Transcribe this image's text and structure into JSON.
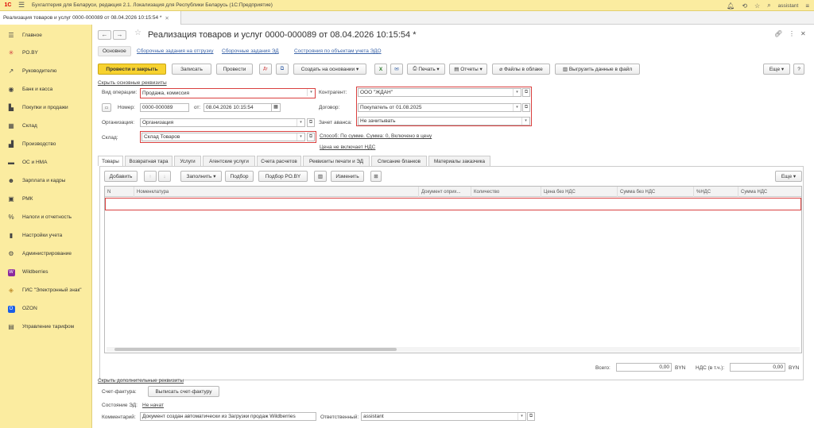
{
  "titlebar": {
    "logo": "1С",
    "app_title": "Бухгалтерия для Беларуси, редакция 2.1. Локализация для Республики Беларусь   (1С:Предприятие)",
    "user": "assistant"
  },
  "doc_tab": {
    "label": "Реализация товаров и услуг 0000-000089 от 08.04.2026 10:15:54 *",
    "close": "✕"
  },
  "sidebar": {
    "items": [
      {
        "label": "Главное",
        "icon": "menu-icon"
      },
      {
        "label": "PO.BY",
        "icon": "poby-icon"
      },
      {
        "label": "Руководителю",
        "icon": "chart-icon"
      },
      {
        "label": "Банк и касса",
        "icon": "bank-icon"
      },
      {
        "label": "Покупки и продажи",
        "icon": "cart-icon"
      },
      {
        "label": "Склад",
        "icon": "warehouse-icon"
      },
      {
        "label": "Производство",
        "icon": "factory-icon"
      },
      {
        "label": "ОС и НМА",
        "icon": "car-icon"
      },
      {
        "label": "Зарплата и кадры",
        "icon": "people-icon"
      },
      {
        "label": "РМК",
        "icon": "register-icon"
      },
      {
        "label": "Налоги и отчетность",
        "icon": "percent-icon"
      },
      {
        "label": "Настройки учета",
        "icon": "book-icon"
      },
      {
        "label": "Администрирование",
        "icon": "gear-icon"
      },
      {
        "label": "Wildberries",
        "icon": "wb-icon"
      },
      {
        "label": "ГИС \"Электронный знак\"",
        "icon": "diamond-icon"
      },
      {
        "label": "OZON",
        "icon": "ozon-icon"
      },
      {
        "label": "Управление тарифом",
        "icon": "tariff-icon"
      }
    ]
  },
  "header": {
    "title": "Реализация товаров и услуг 0000-000089 от 08.04.2026 10:15:54 *",
    "back": "←",
    "forward": "→",
    "star": "☆"
  },
  "subtabs": {
    "main": "Основное",
    "link1": "Сборочные задания на отгрузку",
    "link2": "Сборочные задания ЭД",
    "link3": "Сострояния по объектам учета ЭДО"
  },
  "toolbar": {
    "post_close": "Провести и закрыть",
    "save": "Записать",
    "post": "Провести",
    "create_based": "Создать на основании",
    "print": "Печать",
    "reports": "Отчеты",
    "files_cloud": "Файлы в облаке",
    "export_file": "Выгрузить данные в файл",
    "more": "Еще"
  },
  "form": {
    "hide_main_link": "Скрыть основные реквизиты",
    "op_type_label": "Вид операции:",
    "op_type_value": "Продажа, комиссия",
    "number_label": "Номер:",
    "number_value": "0000-000089",
    "date_label": "от:",
    "date_value": "08.04.2026 10:15:54",
    "org_label": "Организация:",
    "org_value": "Организация",
    "warehouse_label": "Склад:",
    "warehouse_value": "Склад Товаров",
    "counterparty_label": "Контрагент:",
    "counterparty_value": "ООО \"ЖДАН\"",
    "contract_label": "Договор:",
    "contract_value": "Покупатель  от 01.08.2025",
    "advance_label": "Зачет аванса:",
    "advance_value": "Не зачитывать",
    "method_link": "Способ: По сумме. Сумма: 0, Включено в цену",
    "vat_link": "Цена не включает НДС"
  },
  "tabs": [
    "Товары",
    "Возвратная тара",
    "Услуги",
    "Агентские услуги",
    "Счета расчетов",
    "Реквизиты печати и ЭД",
    "Списание бланков",
    "Материалы заказчика"
  ],
  "tab_toolbar": {
    "add": "Добавить",
    "up": "↑",
    "down": "↓",
    "fill": "Заполнить",
    "select": "Подбор",
    "select_poby": "Подбор PO.BY",
    "change": "Изменить",
    "more": "Еще"
  },
  "grid": {
    "columns": [
      "N",
      "Номенклатура",
      "Документ оприх...",
      "Количество",
      "Цена без НДС",
      "Сумма без НДС",
      "%НДС",
      "Сумма НДС"
    ]
  },
  "totals": {
    "total_label": "Всего:",
    "total_value": "0,00",
    "currency": "BYN",
    "vat_label": "НДС (в т.ч.):",
    "vat_value": "0,00",
    "vat_currency": "BYN"
  },
  "footer": {
    "hide_extra_link": "Скрыть дополнительные реквизиты",
    "invoice_label": "Счет-фактура:",
    "invoice_button": "Выписать счет-фактуру",
    "ed_state_label": "Состояние ЭД:",
    "ed_state_value": "Не начат",
    "comment_label": "Комментарий:",
    "comment_value": "Документ создан автоматически из Загрузки продаж Wildberries",
    "responsible_label": "Ответственный:",
    "responsible_value": "assistant"
  },
  "colors": {
    "sidebar_bg": "#fbeca0",
    "primary_button": "#f7d22f",
    "highlight_border": "#d9403f",
    "link": "#3b64a8"
  }
}
